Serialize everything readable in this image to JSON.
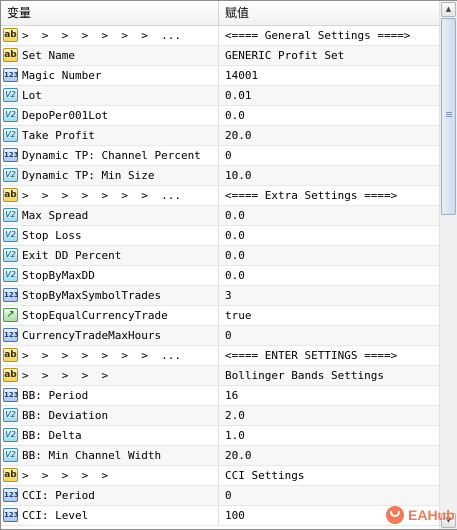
{
  "header": {
    "col_variable": "变量",
    "col_value": "赋值"
  },
  "rows": [
    {
      "icon": "ab",
      "name": ">  >  >  >  >  >  >  ...",
      "value": "<==== General Settings ====>"
    },
    {
      "icon": "ab",
      "name": "Set Name",
      "value": "GENERIC Profit Set"
    },
    {
      "icon": "123",
      "name": "Magic Number",
      "value": "14001"
    },
    {
      "icon": "v2",
      "name": "Lot",
      "value": "0.01"
    },
    {
      "icon": "v2",
      "name": "DepoPer001Lot",
      "value": "0.0"
    },
    {
      "icon": "v2",
      "name": "Take Profit",
      "value": "20.0"
    },
    {
      "icon": "123",
      "name": "Dynamic TP: Channel Percent",
      "value": "0"
    },
    {
      "icon": "v2",
      "name": "Dynamic TP: Min Size",
      "value": "10.0"
    },
    {
      "icon": "ab",
      "name": ">  >  >  >  >  >  >  ...",
      "value": "<==== Extra Settings ====>"
    },
    {
      "icon": "v2",
      "name": "Max Spread",
      "value": "0.0"
    },
    {
      "icon": "v2",
      "name": "Stop Loss",
      "value": "0.0"
    },
    {
      "icon": "v2",
      "name": "Exit DD Percent",
      "value": "0.0"
    },
    {
      "icon": "v2",
      "name": "StopByMaxDD",
      "value": "0.0"
    },
    {
      "icon": "123",
      "name": "StopByMaxSymbolTrades",
      "value": "3"
    },
    {
      "icon": "bool",
      "name": "StopEqualCurrencyTrade",
      "value": "true"
    },
    {
      "icon": "123",
      "name": "CurrencyTradeMaxHours",
      "value": "0"
    },
    {
      "icon": "ab",
      "name": ">  >  >  >  >  >  >  ...",
      "value": "<==== ENTER SETTINGS ====>"
    },
    {
      "icon": "ab",
      "name": ">  >  >  >  >",
      "value": "Bollinger Bands Settings"
    },
    {
      "icon": "123",
      "name": "BB: Period",
      "value": "16"
    },
    {
      "icon": "v2",
      "name": "BB: Deviation",
      "value": "2.0"
    },
    {
      "icon": "v2",
      "name": "BB: Delta",
      "value": "1.0"
    },
    {
      "icon": "v2",
      "name": "BB: Min Channel Width",
      "value": "20.0"
    },
    {
      "icon": "ab",
      "name": ">  >  >  >  >",
      "value": "CCI Settings"
    },
    {
      "icon": "123",
      "name": "CCI: Period",
      "value": "0"
    },
    {
      "icon": "123",
      "name": "CCI: Level",
      "value": "100"
    }
  ],
  "icon_glyphs": {
    "ab": "ab",
    "123": "123",
    "v2": "V2",
    "bool": "↗"
  },
  "watermark": {
    "text": "EAHub"
  },
  "colors": {
    "grid_line": "#e8e8e8",
    "watermark": "#f07a5a"
  }
}
